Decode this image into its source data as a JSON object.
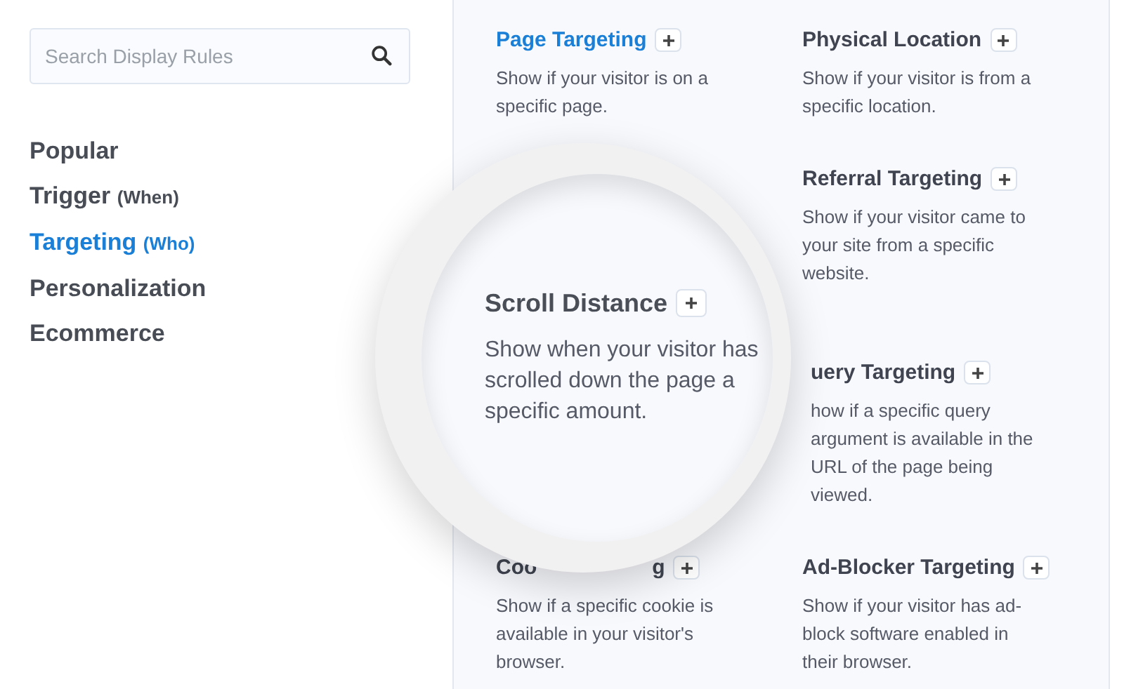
{
  "search": {
    "placeholder": "Search Display Rules"
  },
  "categories": [
    {
      "label": "Popular",
      "selected": false
    },
    {
      "label": "Trigger",
      "qualifier": "(When)",
      "selected": false
    },
    {
      "label": "Targeting",
      "qualifier": "(Who)",
      "selected": true
    },
    {
      "label": "Personalization",
      "selected": false
    },
    {
      "label": "Ecommerce",
      "selected": false
    }
  ],
  "rules": [
    {
      "title": "Page Targeting",
      "description": "Show if your visitor is on a specific page.",
      "selected": true
    },
    {
      "title": "Physical Location",
      "description": "Show if your visitor is from a specific location.",
      "selected": false
    },
    {
      "kind": "hidden"
    },
    {
      "title": "Referral Targeting",
      "description": "Show if your visitor came to your site from a specific website.",
      "selected": false
    },
    {
      "kind": "hidden"
    },
    {
      "title": "uery Targeting",
      "description": "how if a specific query argument is available in the URL of the page being viewed.",
      "selected": false
    },
    {
      "kind": "split",
      "title": "Coo",
      "title_tail": "g",
      "description": "Show if a specific cookie is available in your visitor's browser.",
      "selected": false
    },
    {
      "title": "Ad-Blocker Targeting",
      "description": "Show if your visitor has ad-block software enabled in their browser.",
      "selected": false
    }
  ],
  "magnifier": {
    "title": "Scroll Distance",
    "description": "Show when your visitor has scrolled down the page a specific amount."
  }
}
